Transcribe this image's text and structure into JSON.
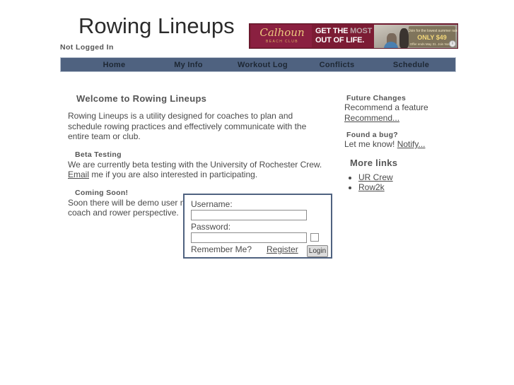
{
  "header": {
    "site_title": "Rowing Lineups",
    "login_status": "Not Logged In"
  },
  "ad": {
    "brand_script": "Calhoun",
    "brand_sub": "BEACH CLUB",
    "headline_line1_a": "GET THE ",
    "headline_line1_b": "MOST",
    "headline_line2": "OUT OF LIFE.",
    "callout_line1": "Join for the lowest summer rate,",
    "callout_line2": "ONLY $49",
    "callout_line3": "Offer ends May 31. Join Now ▶",
    "info_icon": "i",
    "colors": {
      "maroon": "#7c1c34",
      "gold": "#ecc97d"
    }
  },
  "nav": {
    "items": [
      {
        "label": "Home"
      },
      {
        "label": "My Info"
      },
      {
        "label": "Workout Log"
      },
      {
        "label": "Conflicts"
      },
      {
        "label": "Schedule"
      }
    ],
    "bar_color": "#4f6280"
  },
  "main": {
    "welcome_title": "Welcome to Rowing Lineups",
    "welcome_text": "Rowing Lineups is a utility designed for coaches to plan and schedule rowing practices and effectively communicate with the entire team or club.",
    "beta_title": "Beta Testing",
    "beta_text_before": "We are currently beta testing with the University of Rochester Crew. ",
    "beta_link": "Email",
    "beta_text_after": " me if you are also interested in participating.",
    "soon_title": "Coming Soon!",
    "soon_text": "Soon there will be demo user names to try this out from both the coach and rower perspective."
  },
  "sidebar": {
    "future_title": "Future Changes",
    "future_text": "Recommend a feature",
    "future_link": "Recommend...",
    "bug_title": "Found a bug?",
    "bug_text": "Let me know! ",
    "bug_link": "Notify...",
    "more_links_title": "More links",
    "links": [
      {
        "label": "UR Crew"
      },
      {
        "label": "Row2k"
      }
    ]
  },
  "login": {
    "username_label": "Username:",
    "username_value": "",
    "username_placeholder": "",
    "password_label": "Password:",
    "password_value": "",
    "password_placeholder": "",
    "remember_label": "Remember Me?",
    "register_label": "Register",
    "login_button": "Login",
    "border_color": "#4f6280"
  }
}
